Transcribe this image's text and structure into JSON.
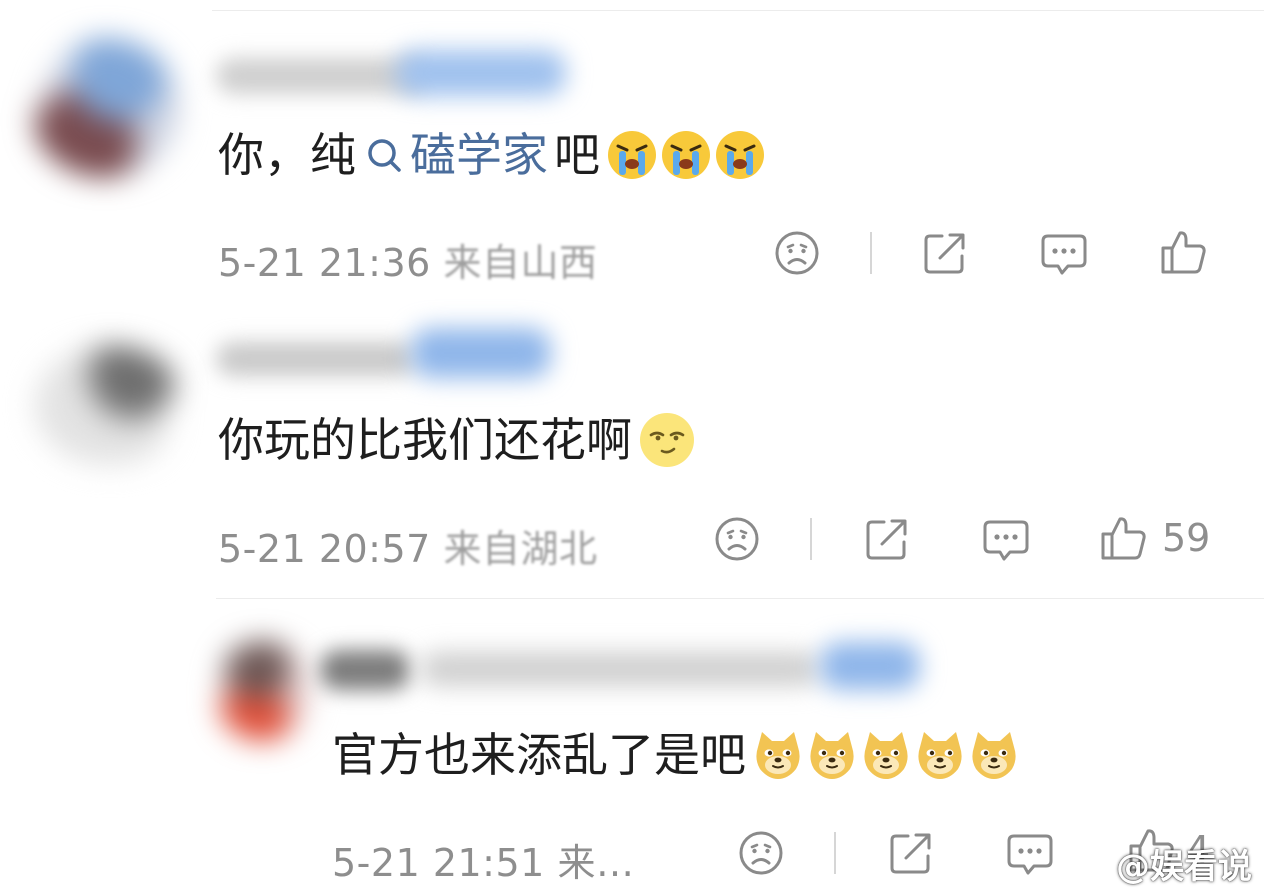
{
  "comments": [
    {
      "text_before": "你，纯",
      "topic": "磕学家",
      "text_after": " 吧",
      "emojis": [
        "crying-face",
        "crying-face",
        "crying-face"
      ],
      "time": "5-21 21:36",
      "location": "来自山西",
      "like_count": ""
    },
    {
      "text_before": "你玩的比我们还花啊",
      "topic": "",
      "text_after": "",
      "emojis": [
        "smug-moon-face"
      ],
      "time": "5-21 20:57",
      "location": "来自湖北",
      "like_count": "59"
    },
    {
      "text_before": "官方也来添乱了是吧",
      "topic": "",
      "text_after": "",
      "emojis": [
        "doge-face",
        "doge-face",
        "doge-face",
        "doge-face",
        "doge-face"
      ],
      "time": "5-21 21:51",
      "location": "来…",
      "like_count": "4"
    }
  ],
  "watermark": {
    "text": "@娱看说",
    "icon": "weibo-logo-icon"
  },
  "colors": {
    "topic_link": "#4a6d9c",
    "meta_text": "#8e8e8e",
    "icon_stroke": "#8a8a8a",
    "emoji_yellow": "#f8c93a"
  }
}
